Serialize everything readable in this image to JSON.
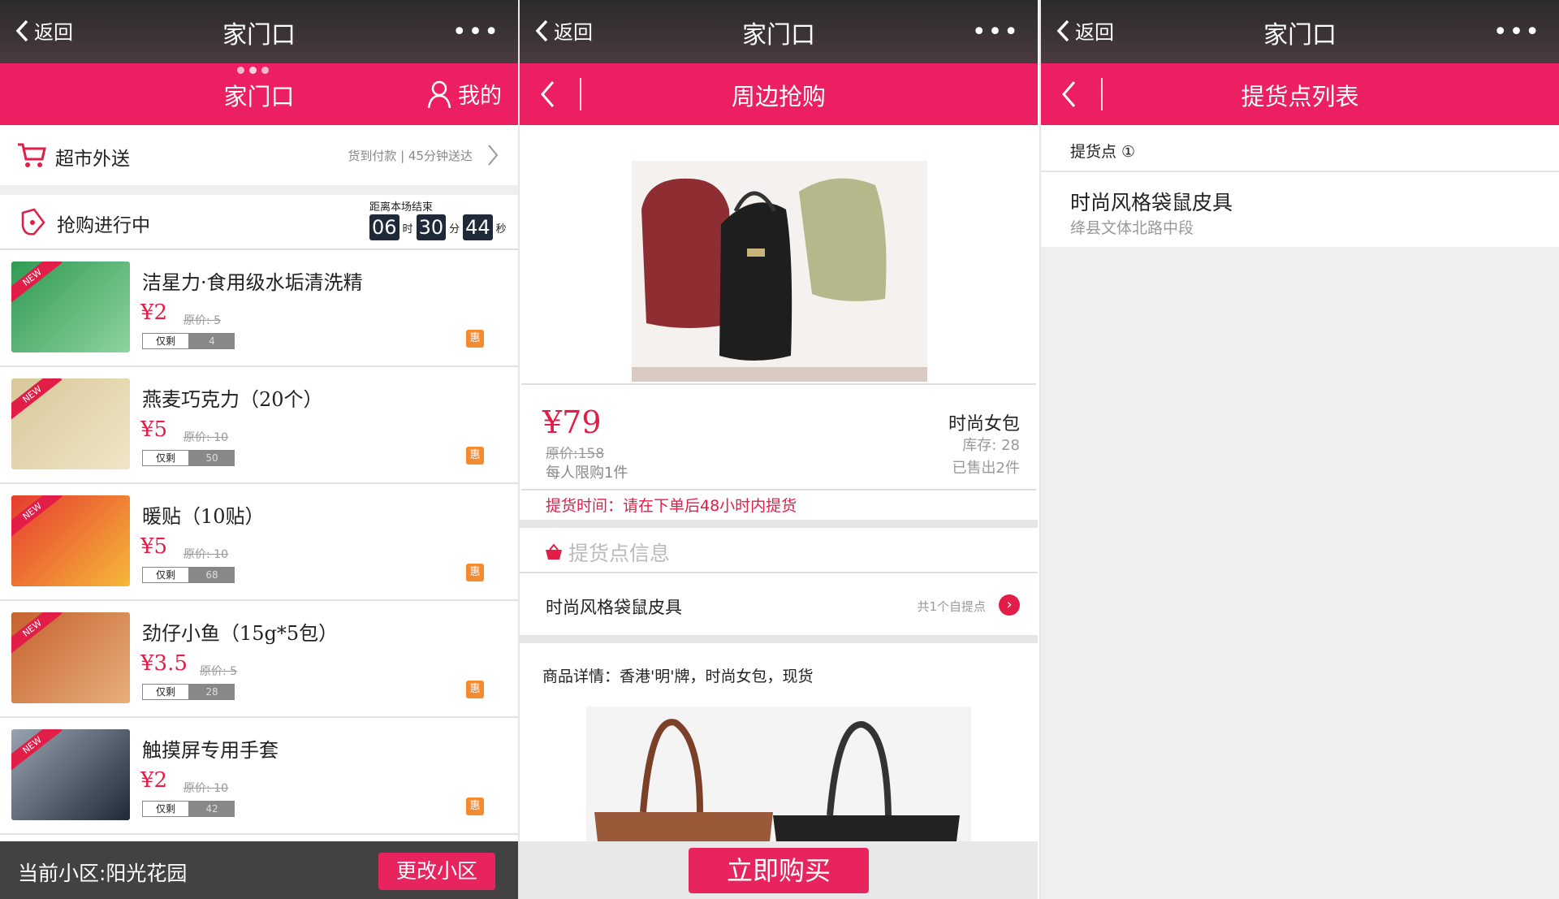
{
  "panel1": {
    "wx": {
      "back": "返回",
      "title": "家门口",
      "more": "•••"
    },
    "header": {
      "title": "家门口",
      "mine": "我的"
    },
    "supermarket": {
      "label": "超市外送",
      "sub": "货到付款 | 45分钟送达"
    },
    "flash": {
      "label": "抢购进行中",
      "countdown_title": "距离本场结束",
      "hours": "06",
      "h": "时",
      "minutes": "30",
      "m": "分",
      "seconds": "44",
      "s": "秒"
    },
    "items": [
      {
        "name": "洁星力·食用级水垢清洗精",
        "price": "¥2",
        "orig": "原价: 5",
        "left_label": "仅剩",
        "left": "4",
        "tag": "惠"
      },
      {
        "name": "燕麦巧克力（20个）",
        "price": "¥5",
        "orig": "原价: 10",
        "left_label": "仅剩",
        "left": "50",
        "tag": "惠"
      },
      {
        "name": "暖贴（10贴）",
        "price": "¥5",
        "orig": "原价: 10",
        "left_label": "仅剩",
        "left": "68",
        "tag": "惠"
      },
      {
        "name": "劲仔小鱼（15g*5包）",
        "price": "¥3.5",
        "orig": "原价: 5",
        "left_label": "仅剩",
        "left": "28",
        "tag": "惠"
      },
      {
        "name": "触摸屏专用手套",
        "price": "¥2",
        "orig": "原价: 10",
        "left_label": "仅剩",
        "left": "42",
        "tag": "惠"
      }
    ],
    "footer": {
      "community": "当前小区:阳光花园",
      "change": "更改小区"
    }
  },
  "panel2": {
    "wx": {
      "back": "返回",
      "title": "家门口",
      "more": "•••"
    },
    "header": {
      "title": "周边抢购"
    },
    "price": "¥79",
    "orig": "原价:158",
    "limit": "每人限购1件",
    "name": "时尚女包",
    "stock": "库存: 28",
    "sold": "已售出2件",
    "pickup_time": "提货时间：请在下单后48小时内提货",
    "pickup_info": "提货点信息",
    "shop": "时尚风格袋鼠皮具",
    "shop_count": "共1个自提点",
    "detail": "商品详情：香港'明'牌，时尚女包，现货",
    "buy": "立即购买"
  },
  "panel3": {
    "wx": {
      "back": "返回",
      "title": "家门口",
      "more": "•••"
    },
    "header": {
      "title": "提货点列表"
    },
    "list_head": "提货点 ①",
    "point": {
      "name": "时尚风格袋鼠皮具",
      "address": "绛县文体北路中段"
    }
  },
  "colors": {
    "brand": "#ec1f62",
    "price": "#e11d48",
    "tag": "#f58a2e"
  }
}
